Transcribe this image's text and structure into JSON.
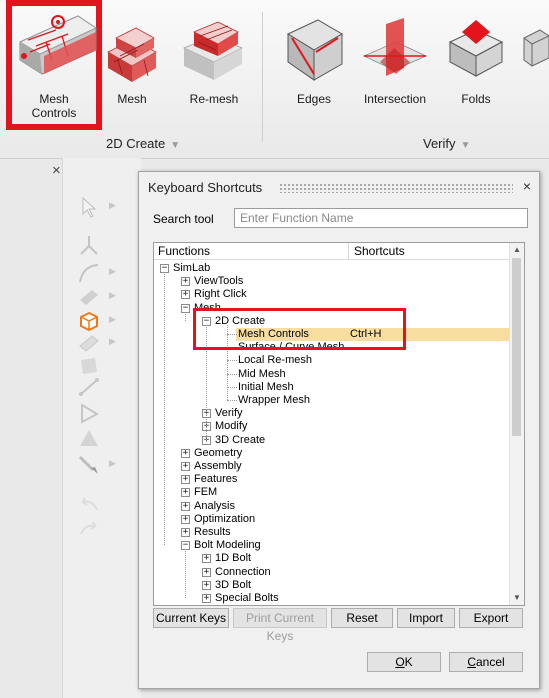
{
  "ribbon": {
    "buttons": [
      {
        "label": "Mesh\nControls",
        "icon": "mesh-controls-icon",
        "active": true
      },
      {
        "label": "Mesh",
        "icon": "mesh-icon",
        "active": false
      },
      {
        "label": "Re-mesh",
        "icon": "remesh-icon",
        "active": false
      },
      {
        "label": "Edges",
        "icon": "edges-icon",
        "active": false
      },
      {
        "label": "Intersection",
        "icon": "intersection-icon",
        "active": false
      },
      {
        "label": "Folds",
        "icon": "folds-icon",
        "active": false
      }
    ],
    "groups": {
      "create": "2D Create",
      "verify": "Verify"
    },
    "dropdown_arrow": "▼",
    "accent_color": "#e3141b"
  },
  "panel": {
    "close": "×"
  },
  "dialog": {
    "title": "Keyboard Shortcuts",
    "close": "×",
    "search_label": "Search tool",
    "search_placeholder": "Enter Function Name",
    "columns": {
      "functions": "Functions",
      "shortcuts": "Shortcuts"
    },
    "tree": [
      {
        "label": "SimLab",
        "exp": "−"
      },
      {
        "label": "ViewTools",
        "exp": "+"
      },
      {
        "label": "Right Click",
        "exp": "+"
      },
      {
        "label": "Mesh",
        "exp": "−"
      },
      {
        "label": "2D Create",
        "exp": "−"
      },
      {
        "label": "Mesh Controls",
        "shortcut": "Ctrl+H",
        "selected": true
      },
      {
        "label": "Surface / Curve Mesh"
      },
      {
        "label": "Local Re-mesh"
      },
      {
        "label": "Mid Mesh"
      },
      {
        "label": "Initial Mesh"
      },
      {
        "label": "Wrapper Mesh"
      },
      {
        "label": "Verify",
        "exp": "+"
      },
      {
        "label": "Modify",
        "exp": "+"
      },
      {
        "label": "3D Create",
        "exp": "+"
      },
      {
        "label": "Geometry",
        "exp": "+"
      },
      {
        "label": "Assembly",
        "exp": "+"
      },
      {
        "label": "Features",
        "exp": "+"
      },
      {
        "label": "FEM",
        "exp": "+"
      },
      {
        "label": "Analysis",
        "exp": "+"
      },
      {
        "label": "Optimization",
        "exp": "+"
      },
      {
        "label": "Results",
        "exp": "+"
      },
      {
        "label": "Bolt Modeling",
        "exp": "−"
      },
      {
        "label": "1D Bolt",
        "exp": "+"
      },
      {
        "label": "Connection",
        "exp": "+"
      },
      {
        "label": "3D Bolt",
        "exp": "+"
      },
      {
        "label": "Special Bolts",
        "exp": "+"
      }
    ],
    "buttons": {
      "current_keys": "Current Keys",
      "print_current_keys": "Print Current Keys",
      "reset": "Reset",
      "import": "Import",
      "export": "Export",
      "ok_key": "O",
      "ok_rest": "K",
      "cancel_key": "C",
      "cancel_rest": "ancel"
    },
    "scroll": {
      "up": "▲",
      "down": "▼"
    }
  }
}
